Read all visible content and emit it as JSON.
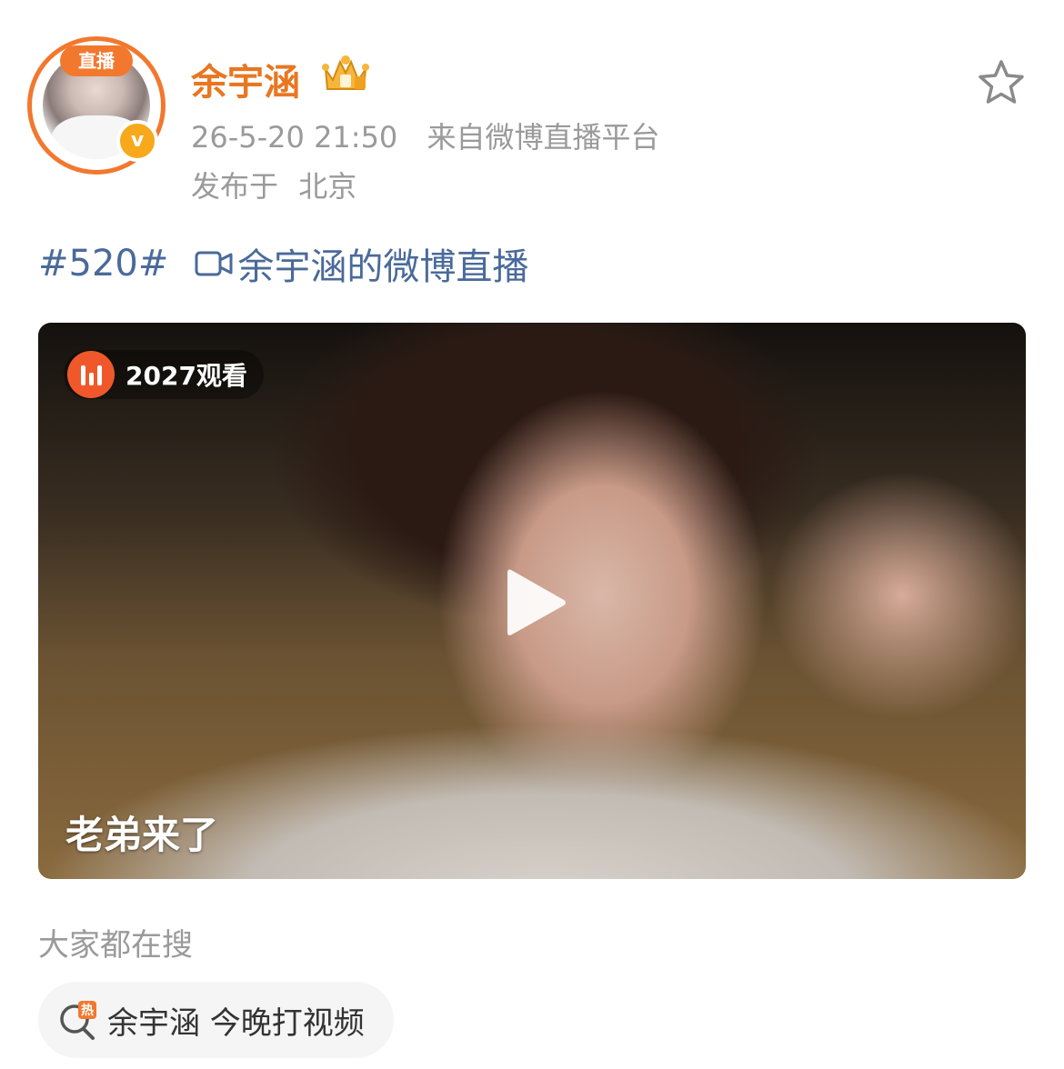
{
  "header": {
    "live_badge": "直播",
    "verified_icon": "verified-v-icon",
    "username": "余宇涵",
    "crown_icon": "crown-badge-icon",
    "timestamp": "26-5-20 21:50",
    "source": "来自微博直播平台",
    "location_prefix": "发布于",
    "location": "北京",
    "favorite_icon": "star-outline-icon"
  },
  "post": {
    "hashtag": "#520#",
    "live_link_icon": "video-camera-icon",
    "live_link": "余宇涵的微博直播"
  },
  "video": {
    "stats_icon": "live-bars-icon",
    "view_count": "2027观看",
    "play_icon": "play-icon",
    "caption": "老弟来了"
  },
  "search": {
    "title": "大家都在搜",
    "chip_icon": "hot-search-icon",
    "chip_label": "余宇涵 今晚打视频"
  },
  "colors": {
    "accent": "#f2782e",
    "username": "#e87722",
    "link": "#4a6a9a",
    "muted": "#9a9a9a"
  }
}
